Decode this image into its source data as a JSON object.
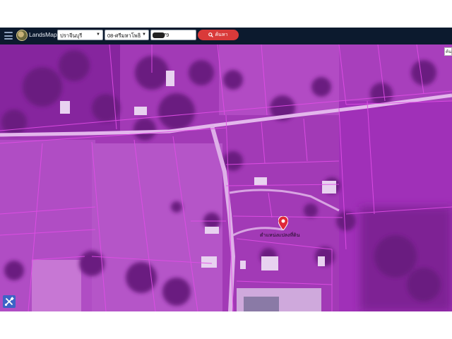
{
  "header": {
    "brand": "LandsMaps",
    "province": "ปราจีนบุรี",
    "district": "08-ศรีมหาโพธิ",
    "parcel_suffix": "79",
    "search_label": "ค้นหา"
  },
  "map": {
    "corner_label": "ค้น",
    "marker_label": "ตำแหน่งแปลงที่ดิน"
  },
  "icons": {
    "menu": "hamburger-menu-icon",
    "logo": "landsmaps-logo-icon",
    "search": "search-icon",
    "marker": "map-marker-icon",
    "tools": "tools-icon"
  },
  "colors": {
    "topbar": "#0c1a2e",
    "search_button": "#d93a3a",
    "parcel_overlay": "#c82bd6",
    "marker": "#e0283a",
    "tool_button": "#3d63c6"
  }
}
